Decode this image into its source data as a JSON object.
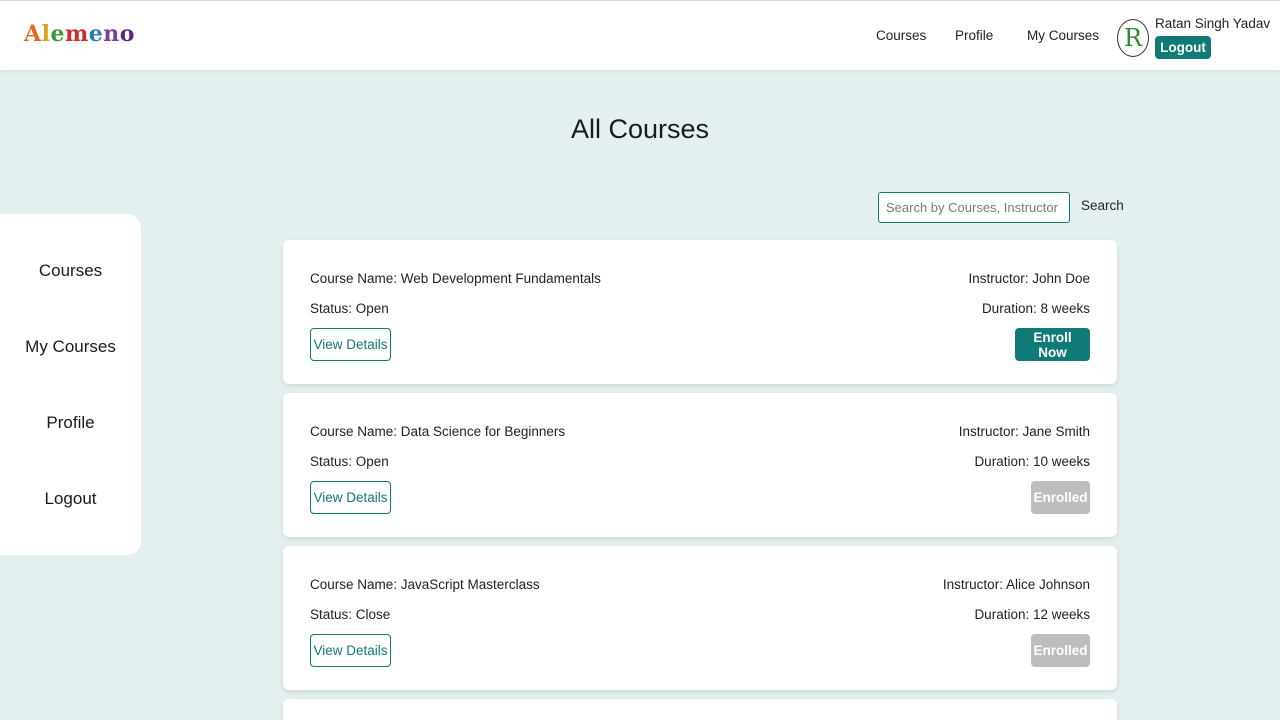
{
  "header": {
    "logo_letters": [
      "A",
      "l",
      "e",
      "m",
      "e",
      "n",
      "o"
    ],
    "nav": [
      "Courses",
      "Profile",
      "My Courses"
    ],
    "avatar_initial": "R",
    "user_name": "Ratan Singh Yadav",
    "logout_label": "Logout"
  },
  "page": {
    "title": "All Courses"
  },
  "search": {
    "placeholder": "Search by Courses, Instructor",
    "value": "",
    "button_label": "Search"
  },
  "sidebar": {
    "items": [
      "Courses",
      "My Courses",
      "Profile",
      "Logout"
    ]
  },
  "courses": [
    {
      "name": "Course Name: Web Development Fundamentals",
      "status": "Status: Open",
      "instructor": "Instructor: John Doe",
      "duration": "Duration: 8 weeks",
      "view_label": "View Details",
      "action_label": "Enroll Now",
      "action_state": "enroll"
    },
    {
      "name": "Course Name: Data Science for Beginners",
      "status": "Status: Open",
      "instructor": "Instructor: Jane Smith",
      "duration": "Duration: 10 weeks",
      "view_label": "View Details",
      "action_label": "Enrolled",
      "action_state": "enrolled"
    },
    {
      "name": "Course Name: JavaScript Masterclass",
      "status": "Status: Close",
      "instructor": "Instructor: Alice Johnson",
      "duration": "Duration: 12 weeks",
      "view_label": "View Details",
      "action_label": "Enrolled",
      "action_state": "enrolled"
    }
  ],
  "colors": {
    "accent": "#0f7a76",
    "background": "#e4f0ef",
    "disabled": "#bdbdbd"
  }
}
